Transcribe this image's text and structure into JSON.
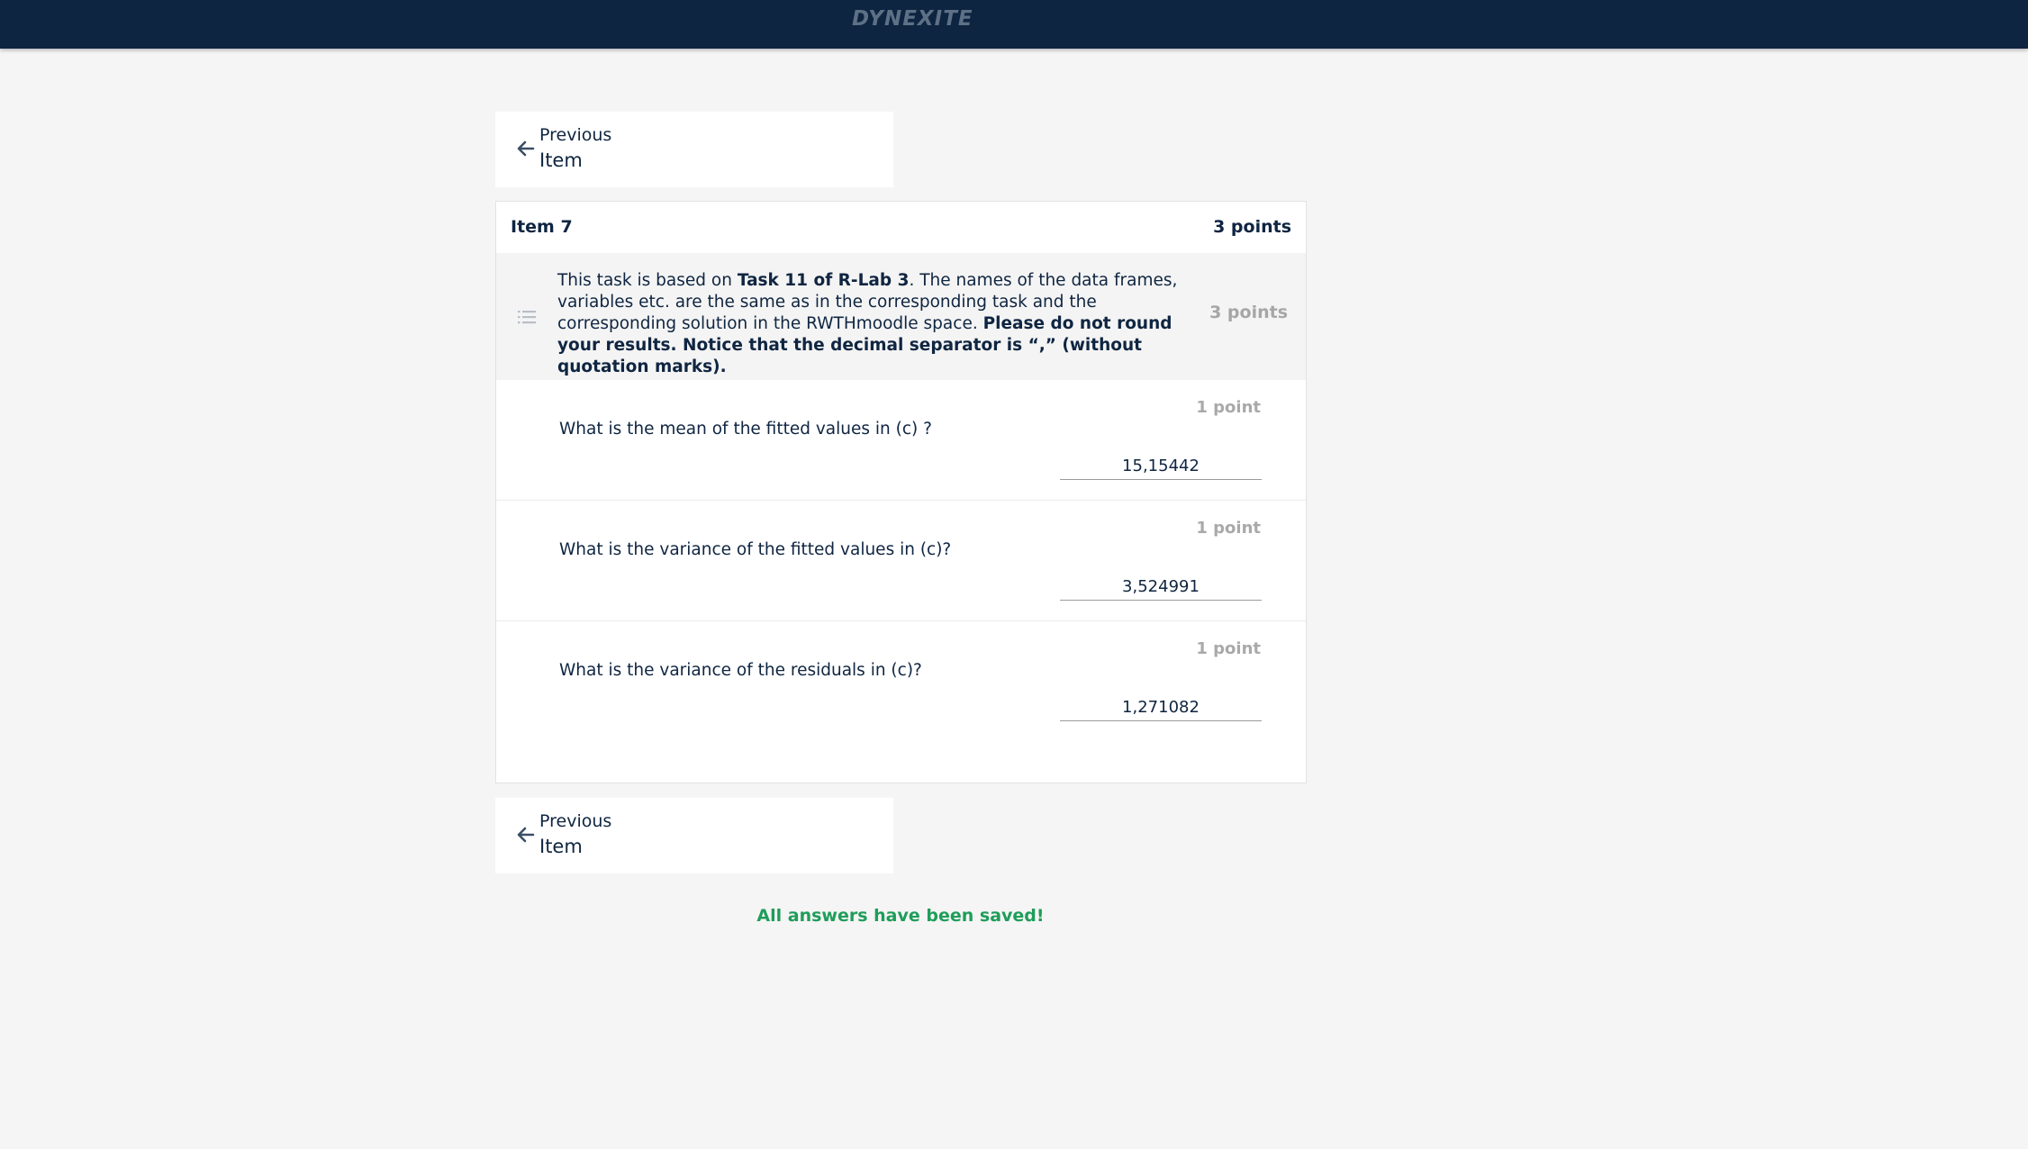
{
  "header": {
    "logo_text": "DYNEXITE"
  },
  "nav": {
    "previous_line1": "Previous",
    "previous_line2": "Item"
  },
  "item": {
    "title": "Item 7",
    "points": "3 points",
    "task": {
      "text_1": "This task is based on ",
      "bold_1": "Task 11 of R-Lab 3",
      "text_2": ". The names of the data frames, variables etc. are the same as in the corresponding task and the corresponding solution in the RWTHmoodle space. ",
      "bold_2": "Please do not round your results. Notice that the decimal separator is “,” (without quotation marks).",
      "points": "3 points"
    },
    "questions": [
      {
        "points": "1 point",
        "text": "What is the mean of the fitted values in (c) ?",
        "answer": "15,15442"
      },
      {
        "points": "1 point",
        "text": "What is the variance of the fitted values in (c)?",
        "answer": "3,524991"
      },
      {
        "points": "1 point",
        "text": "What is the variance of the residuals in (c)?",
        "answer": "1,271082"
      }
    ]
  },
  "status": {
    "saved_message": "All answers have been saved!",
    "saved_color": "#1f9d5a"
  },
  "colors": {
    "topbar": "#0d2540",
    "text": "#0f2541",
    "background": "#f5f5f5"
  },
  "icons": {
    "nav": "arrow-left-icon",
    "task": "list-icon"
  }
}
